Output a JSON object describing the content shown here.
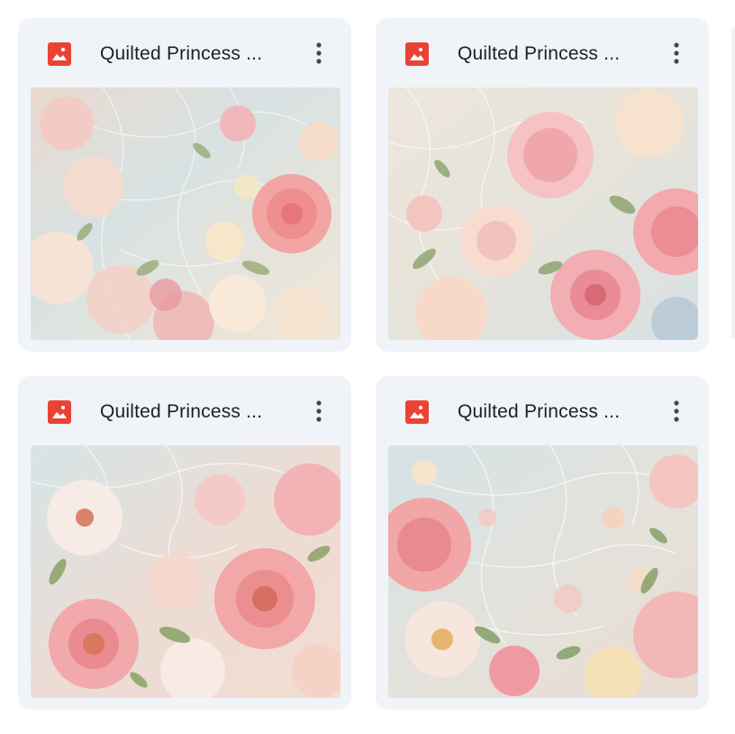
{
  "colors": {
    "card_bg": "#f0f4f9",
    "image_icon": "#ea4335",
    "title_text": "#1f1f1f",
    "menu_icon": "#444746"
  },
  "files": [
    {
      "name": "Quilted Princess ...",
      "type_icon": "image-file-icon",
      "menu_icon": "more-vert-icon"
    },
    {
      "name": "Quilted Princess ...",
      "type_icon": "image-file-icon",
      "menu_icon": "more-vert-icon"
    },
    {
      "name": "Quilted Princess ...",
      "type_icon": "image-file-icon",
      "menu_icon": "more-vert-icon"
    },
    {
      "name": "Quilted Princess ...",
      "type_icon": "image-file-icon",
      "menu_icon": "more-vert-icon"
    }
  ]
}
